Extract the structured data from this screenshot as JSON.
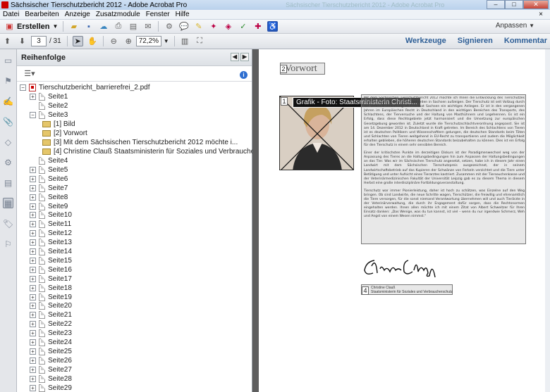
{
  "window": {
    "title": "Sächsischer Tierschutzbericht 2012 - Adobe Acrobat Pro",
    "background_ghost_title": "Sächsischer Tierschutzbericht 2012 - Adobe Acrobat Pro",
    "minimize": "–",
    "maximize": "□",
    "close": "✕"
  },
  "menu": [
    "Datei",
    "Bearbeiten",
    "Anzeige",
    "Zusatzmodule",
    "Fenster",
    "Hilfe"
  ],
  "menu_close": "×",
  "toolbar": {
    "create_label": "Erstellen",
    "customize_label": "Anpassen",
    "page_current": "3",
    "page_total": "/ 31",
    "zoom": "72,2%"
  },
  "right_panes": [
    "Werkzeuge",
    "Signieren",
    "Kommentar"
  ],
  "panel": {
    "title": "Reihenfolge",
    "info": "i",
    "root": "Tierschutzbericht_barrierefrei_2.pdf",
    "pages_before": [
      "Seite1",
      "Seite2"
    ],
    "expanded_page": "Seite3",
    "tags": [
      "[1]  Bild",
      "[2]  Vorwort",
      "[3]  Mit dem Sächsischen Tierschutzbericht 2012 möchte i...",
      "[4]  Christine Clauß Staatsministerin für Soziales und Verbraucherschut..."
    ],
    "pages_after": [
      "Seite4",
      "Seite5",
      "Seite6",
      "Seite7",
      "Seite8",
      "Seite9",
      "Seite10",
      "Seite11",
      "Seite12",
      "Seite13",
      "Seite14",
      "Seite15",
      "Seite16",
      "Seite17",
      "Seite18",
      "Seite19",
      "Seite20",
      "Seite21",
      "Seite22",
      "Seite23",
      "Seite24",
      "Seite25",
      "Seite26",
      "Seite27",
      "Seite28",
      "Seite29"
    ]
  },
  "document": {
    "heading": "Vorwort",
    "tooltip": "Grafik - Foto: Staatsministerin Christi...",
    "markers": [
      "2",
      "1",
      "3",
      "4"
    ],
    "caption_name": "Christine Clauß",
    "caption_role": "Staatsministerin für Soziales und Verbraucherschutz",
    "paragraph1": "Mit dem Sächsischen Tierschutzbericht 2012 möchte ich Ihnen die Entwicklung des Tierschutzes und der Arbeit der Tierschutzbehörden in Sachsen aufzeigen. Der Tierschutz ist seit Vollzug durch die Veterinärverwaltung im Freistaat Sachsen ein wichtiges Anliegen. Er ist in den vergangenen Jahren im Europäischen Recht in Deutschland in den wichtigen Bereichen des Transports, des Schlachtens, der Tierversuche und der Haltung von Masthühnern und Legehennen. Es ist ein Erfolg, dass diese Rechtsgebiete jetzt harmonisiert und die Umsetzung zur europäischen Gesetzgebung geworden ist. Zuletzt wurde die Tierschutzschlachtverordnung angepasst. Sie ist am 14. Dezember 2012 in Deutschland in Kraft getreten. Im Bereich des Schlachtens von Tieren ist es deutschen Politikern und Wissenschaftlern gelungen, die deutschen Standards beim Töten und Schlachten von Tieren weitgehend in EU-Recht zu transportieren und zudem die Möglichkeit erhalten geblieben, die höheren deutschen Standards beizubehalten zu können. Dies ist ein Erfolg für den Tierschutz in einem sehr sensiblen Bereich.",
    "paragraph2": "Einer der kritischsten Punkte im derzeitigen Diskurs ist der Paradigmenwechsel weg von der Anpassung des Tieres an die Haltungsbedingungen hin zum Anpassen der Haltungsbedingungen an das Tier. Was wir im Sächsischen Tierschutz angesetzt, setzen, habe ich in diesem Jahr einen Landwirt mit dem Sächsischen Tierschutzpreis ausgezeichnet, der in seinem Landwirtschaftsbetrieb auf das Kupieren der Schwänze von Ferkeln verzichtet und die Tiere unter Betätigung und unter Aufsicht eines Tierarztes kastriert. Zusammen mit der Tierseuchenkasse und der Veterinärmedizinischen Fakultät der Universität Leipzig gab es zu diesem Thema in diesem Herbst eine große interdisziplinäre Fortbildungsveranstaltung.",
    "paragraph3": "Tierschutz war immer Pionierleistung, daher ist hoch zu schätzen, was Einzelne auf den Weg bringen. Ob sind Landwirte, die neue Schritte wagen, Tierschützer, die freiwillig und ehrenamtlich die Tiere versorgen, für die sonst niemand Verantwortung übernehmen will und auch Tierärzte in der Veterinärverwaltung, die durch ihr Engagement dafür sorgen, dass die Rechtsnormen eingehalten werden. Ihnen allen möchte ich mit einem Zitat von Albert Schweitzer für Ihren Einsatz danken: „Das Wenige, was du tun kannst, ist viel – wenn du nur irgendwie Schmerz, Weh und Angst von einem Wesen nimmst.“"
  }
}
